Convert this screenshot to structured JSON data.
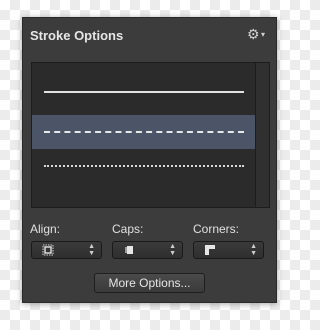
{
  "panel": {
    "title": "Stroke Options",
    "menu_icon": "gear-icon"
  },
  "stroke_list": {
    "items": [
      {
        "style": "solid",
        "selected": false
      },
      {
        "style": "dashed",
        "selected": true
      },
      {
        "style": "dotted",
        "selected": false
      }
    ]
  },
  "align": {
    "label": "Align:",
    "icon": "align-inside-icon"
  },
  "caps": {
    "label": "Caps:",
    "icon": "cap-square-icon"
  },
  "corners": {
    "label": "Corners:",
    "icon": "corner-miter-icon"
  },
  "more_options": {
    "label": "More Options..."
  },
  "colors": {
    "panel_bg": "#3c3c3c",
    "selection": "#4c5568",
    "text": "#e0e0e0"
  }
}
